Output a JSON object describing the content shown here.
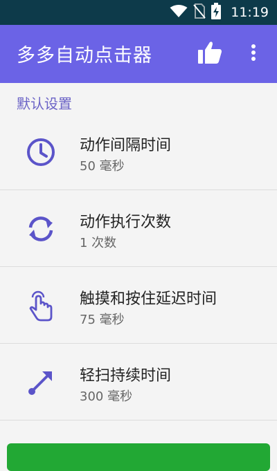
{
  "status_bar": {
    "time": "11:19",
    "icons": [
      "wifi-icon",
      "no-sim-icon",
      "battery-charging-icon"
    ]
  },
  "app_bar": {
    "title": "多多自动点击器",
    "actions": [
      "thumbs-up-icon",
      "more-vert-icon"
    ],
    "color": "#6b63e6"
  },
  "section": {
    "title": "默认设置"
  },
  "settings": [
    {
      "icon": "clock-icon",
      "title": "动作间隔时间",
      "value": "50 毫秒"
    },
    {
      "icon": "sync-icon",
      "title": "动作执行次数",
      "value": "1 次数"
    },
    {
      "icon": "touch-icon",
      "title": "触摸和按住延迟时间",
      "value": "75 毫秒"
    },
    {
      "icon": "swipe-arrow-icon",
      "title": "轻扫持续时间",
      "value": "300 毫秒"
    }
  ],
  "colors": {
    "accent": "#6b63e6",
    "icon": "#5b54c9",
    "status_bar": "#0d3a4a",
    "start_button": "#22a834"
  }
}
